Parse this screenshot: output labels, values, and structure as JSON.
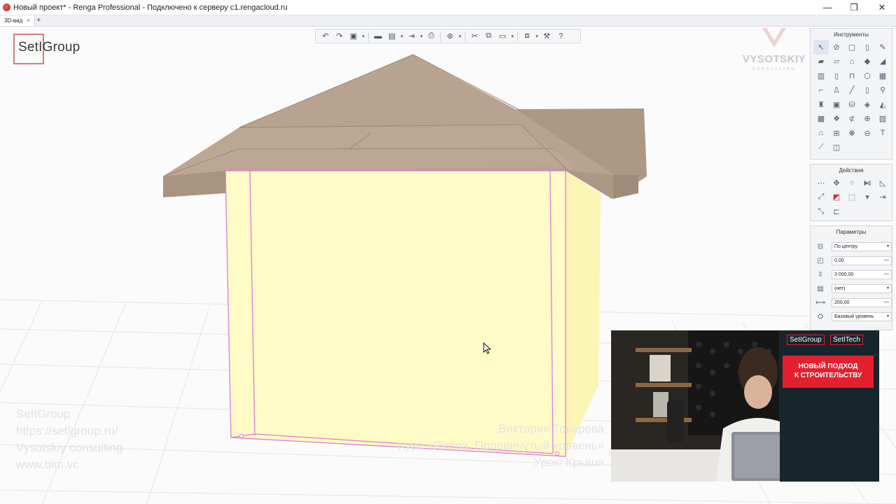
{
  "window": {
    "title": "Новый проект* - Renga Professional - Подключено к серверу c1.rengacloud.ru",
    "minimize": "—",
    "maximize": "❐",
    "close": "✕"
  },
  "tabs": [
    {
      "label": "3D-вид",
      "close": "×"
    }
  ],
  "tab_add": "+",
  "branding": {
    "logo": "SetIGroup",
    "vysotskiy": "VYSOTSKIY",
    "vysotskiy_sub": "CONSULTING",
    "accent_color": "#e0787a"
  },
  "panels": {
    "tools": {
      "title": "Инструменты"
    },
    "actions": {
      "title": "Действия"
    },
    "params": {
      "title": "Параметры",
      "rows": [
        {
          "icon": "alignment-icon",
          "value": "По центру",
          "type": "select"
        },
        {
          "icon": "offset-icon",
          "value": "0,00",
          "unit": "мм",
          "type": "input"
        },
        {
          "icon": "height-icon",
          "value": "3 000,00",
          "unit": "мм",
          "type": "input"
        },
        {
          "icon": "material-icon",
          "value": "(нет)",
          "type": "select"
        },
        {
          "icon": "thickness-icon",
          "value": "200,00",
          "unit": "мм",
          "type": "input"
        },
        {
          "icon": "level-icon",
          "value": "Базовый уровень",
          "type": "select"
        }
      ]
    }
  },
  "watermark_left": [
    "SetIGroup",
    "https://setlgroup.ru/",
    "Vysotskiy consulting",
    "www.bim.vc"
  ],
  "watermark_right": [
    "Виктория Токарева",
    "Курс «Renga. Продвинутый уровень»",
    "Урок: Крыши"
  ],
  "webcam": {
    "banner_logos": [
      "SetIGroup",
      "SetITech"
    ],
    "banner_text_1": "НОВЫЙ ПОДХОД",
    "banner_text_2": "К СТРОИТЕЛЬСТВУ"
  },
  "colors": {
    "wall": "#fffbc4",
    "wall_side": "#fcf6b4",
    "roof": "#b5a08e",
    "selection": "#e07ad8"
  }
}
